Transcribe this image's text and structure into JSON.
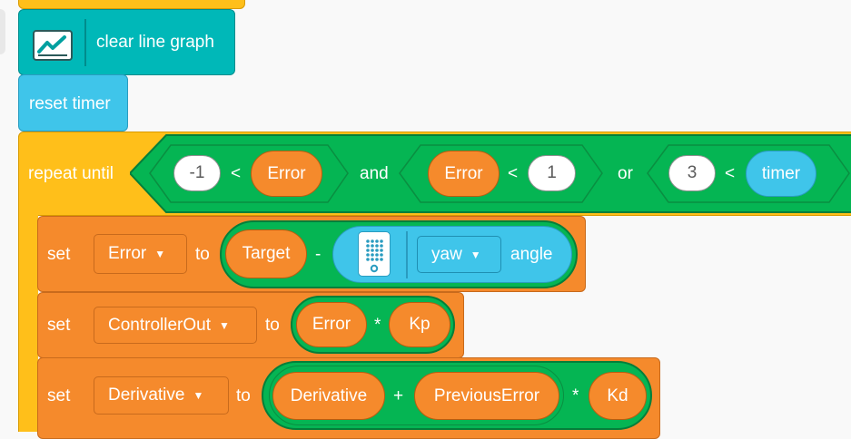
{
  "colors": {
    "event_orange": "#FFBF1A",
    "motor_teal": "#00B8B8",
    "sensor_blue": "#3FC5EA",
    "variable_orange": "#F58A2C",
    "operator_green": "#05B553"
  },
  "blocks": {
    "clear_line_graph": {
      "label": "clear line graph",
      "icon": "line-graph-icon"
    },
    "reset_timer": {
      "label": "reset timer"
    },
    "repeat_until": {
      "label": "repeat until",
      "cond1": {
        "left": "-1",
        "op": "<",
        "right": "Error"
      },
      "and": "and",
      "cond2": {
        "left": "Error",
        "op": "<",
        "right": "1"
      },
      "or": "or",
      "cond3": {
        "left": "3",
        "op": "<",
        "right": "timer"
      }
    },
    "set_error": {
      "set": "set",
      "variable": "Error",
      "to": "to",
      "lhs": "Target",
      "op": "-",
      "hub_icon": "hub-icon",
      "axis": "yaw",
      "angle": "angle"
    },
    "set_controller": {
      "set": "set",
      "variable": "ControllerOut",
      "to": "to",
      "lhs": "Error",
      "op": "*",
      "rhs": "Kp"
    },
    "set_derivative": {
      "set": "set",
      "variable": "Derivative",
      "to": "to",
      "a": "Derivative",
      "plus": "+",
      "b": "PreviousError",
      "times": "*",
      "c": "Kd"
    }
  }
}
